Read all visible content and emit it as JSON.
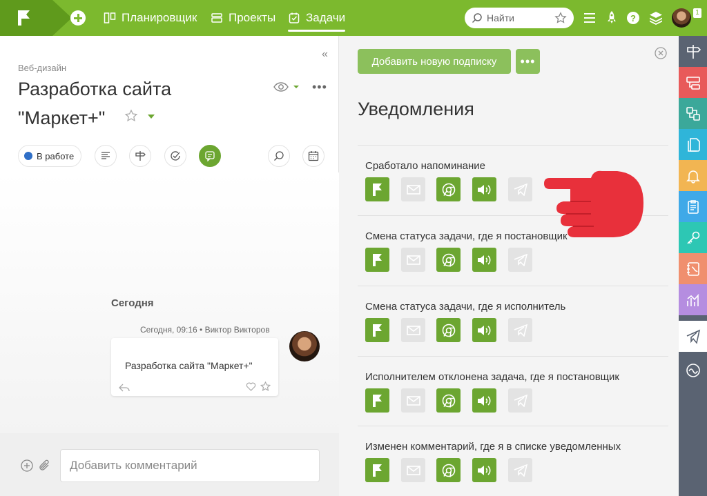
{
  "topbar": {
    "nav": [
      {
        "label": "Планировщик",
        "icon": "planner-icon"
      },
      {
        "label": "Проекты",
        "icon": "projects-icon"
      },
      {
        "label": "Задачи",
        "icon": "tasks-icon",
        "active": true
      }
    ],
    "search_placeholder": "Найти",
    "notification_count": "1"
  },
  "task": {
    "breadcrumb": "Веб-дизайн",
    "title": "Разработка сайта \"Маркет+\"",
    "status": "В работе"
  },
  "feed": {
    "day": "Сегодня",
    "message": {
      "time": "Сегодня, 09:16",
      "author": "Виктор Викторов",
      "text": "Разработка сайта \"Маркет+\""
    }
  },
  "composer": {
    "placeholder": "Добавить комментарий"
  },
  "notifications": {
    "add_subscription_label": "Добавить новую подписку",
    "more_label": "•••",
    "title": "Уведомления",
    "channels": [
      "app-flag",
      "email",
      "chrome",
      "sound",
      "telegram"
    ],
    "rows": [
      {
        "label": "Сработало напоминание",
        "states": [
          true,
          false,
          true,
          true,
          false
        ]
      },
      {
        "label": "Смена статуса задачи, где я постановщик",
        "states": [
          true,
          false,
          true,
          true,
          false
        ]
      },
      {
        "label": "Смена статуса задачи, где я исполнитель",
        "states": [
          true,
          false,
          true,
          true,
          false
        ]
      },
      {
        "label": "Исполнителем отклонена задача, где я постановщик",
        "states": [
          true,
          false,
          true,
          true,
          false
        ]
      },
      {
        "label": "Изменен комментарий, где я в списке уведомленных",
        "states": [
          true,
          false,
          true,
          true,
          false
        ]
      }
    ]
  },
  "colors": {
    "brand_green": "#7cb92e",
    "channel_on": "#6ca631",
    "channel_off": "#e3e3e3",
    "hand_red": "#e8303b",
    "rail_bg": "#5a6372"
  },
  "rail": [
    {
      "icon": "signpost-icon",
      "color": "#5a6372"
    },
    {
      "icon": "structure-icon",
      "color": "#e85a5a"
    },
    {
      "icon": "flow-icon",
      "color": "#3ba89a"
    },
    {
      "icon": "documents-icon",
      "color": "#2fb5d9"
    },
    {
      "icon": "bell-icon",
      "color": "#f2b552"
    },
    {
      "icon": "clipboard-icon",
      "color": "#3fa9e8"
    },
    {
      "icon": "key-icon",
      "color": "#2dc7b4"
    },
    {
      "icon": "contact-book-icon",
      "color": "#f08f6e"
    },
    {
      "icon": "analytics-icon",
      "color": "#b58de0"
    },
    {
      "icon": "telegram-icon",
      "color": "#ffffff"
    },
    {
      "icon": "pulse-icon",
      "color": "#5a6372"
    }
  ]
}
